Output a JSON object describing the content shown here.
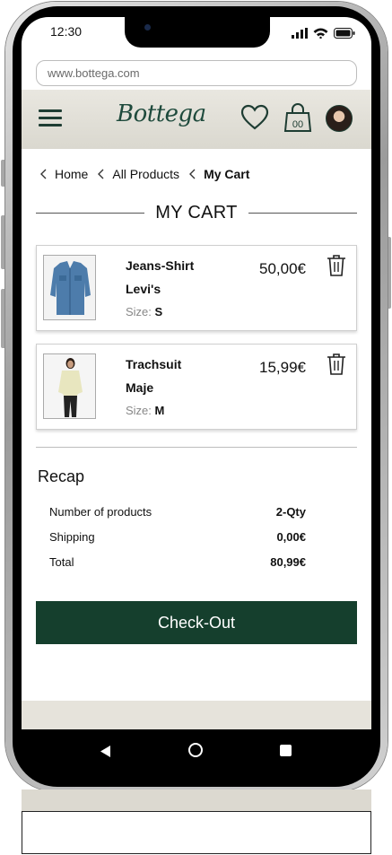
{
  "status_bar": {
    "time": "12:30"
  },
  "browser": {
    "url": "www.bottega.com"
  },
  "header": {
    "logo": "Bottega",
    "bag_count": "00",
    "icons": [
      "menu-icon",
      "heart-icon",
      "shopping-bag-icon",
      "avatar"
    ]
  },
  "breadcrumb": [
    {
      "label": "Home"
    },
    {
      "label": "All Products"
    },
    {
      "label": "My Cart"
    }
  ],
  "page_title": "MY CART",
  "cart_items": [
    {
      "name": "Jeans-Shirt",
      "brand": "Levi's",
      "size_label": "Size:",
      "size": "S",
      "price": "50,00€"
    },
    {
      "name": "Trachsuit",
      "brand": "Maje",
      "size_label": "Size:",
      "size": "M",
      "price": "15,99€"
    }
  ],
  "recap": {
    "title": "Recap",
    "rows": [
      {
        "label": "Number of products",
        "value": "2-Qty"
      },
      {
        "label": "Shipping",
        "value": "0,00€"
      },
      {
        "label": "Total",
        "value": "80,99€"
      }
    ]
  },
  "checkout_label": "Check-Out",
  "colors": {
    "brand_green": "#153f2d",
    "header_bg": "#e9e7e0",
    "accent_dark": "#1e3d33"
  }
}
